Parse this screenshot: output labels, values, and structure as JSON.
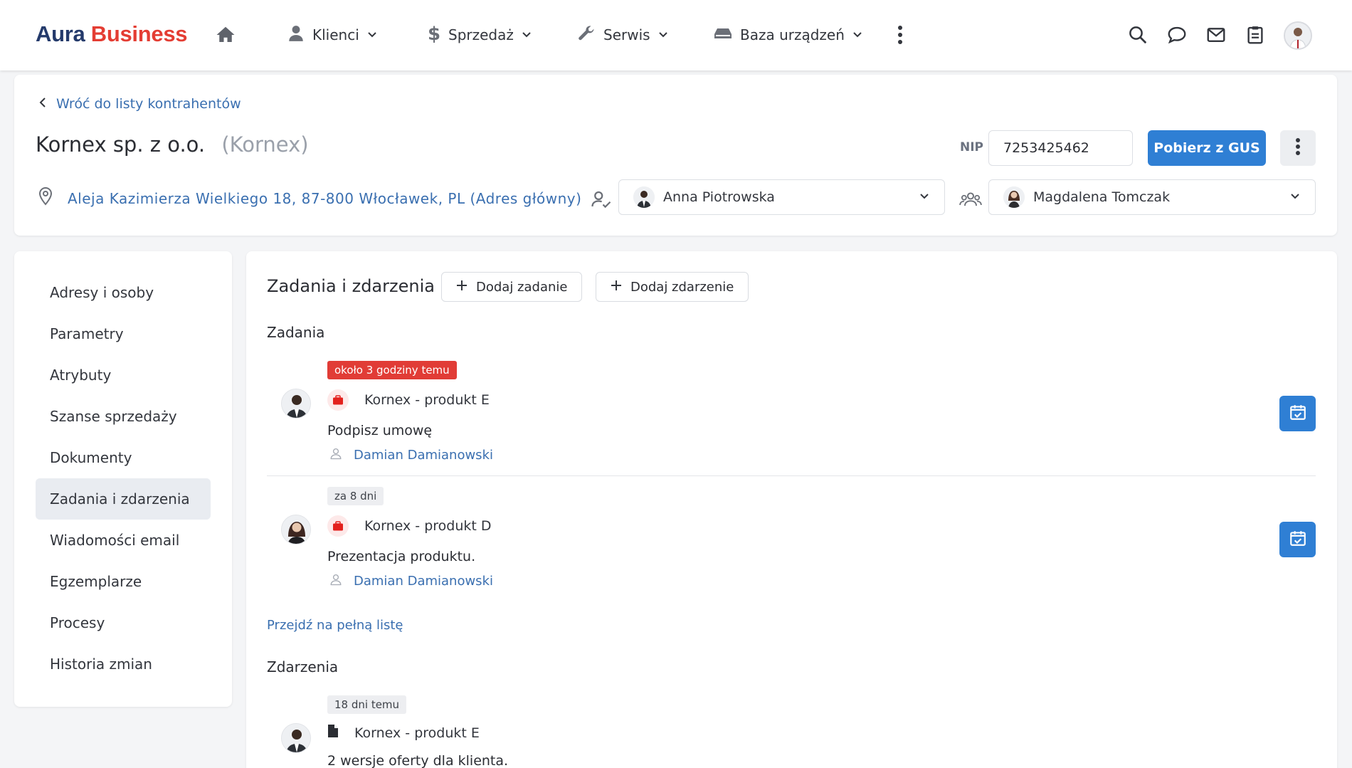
{
  "brand": {
    "part1": "Aura",
    "part2": "Business"
  },
  "nav": {
    "items": [
      {
        "label": "Klienci",
        "icon": "person-icon"
      },
      {
        "label": "Sprzedaż",
        "icon": "dollar-icon"
      },
      {
        "label": "Serwis",
        "icon": "wrench-icon"
      },
      {
        "label": "Baza urządzeń",
        "icon": "devices-icon"
      }
    ],
    "right_icons": [
      "search-icon",
      "chat-icon",
      "mail-icon",
      "clipboard-icon"
    ]
  },
  "header": {
    "back_label": "Wróć do listy kontrahentów",
    "company_name": "Kornex sp. z o.o.",
    "company_short": "(Kornex)",
    "nip_label": "NIP",
    "nip_value": "7253425462",
    "gus_button": "Pobierz z GUS",
    "address": "Aleja Kazimierza Wielkiego 18, 87-800 Włocławek, PL (Adres główny)",
    "owner": "Anna Piotrowska",
    "team": "Magdalena Tomczak"
  },
  "sidebar": {
    "items": [
      {
        "label": "Adresy i osoby"
      },
      {
        "label": "Parametry"
      },
      {
        "label": "Atrybuty"
      },
      {
        "label": "Szanse sprzedaży"
      },
      {
        "label": "Dokumenty"
      },
      {
        "label": "Zadania i zdarzenia",
        "active": true
      },
      {
        "label": "Wiadomości email"
      },
      {
        "label": "Egzemplarze"
      },
      {
        "label": "Procesy"
      },
      {
        "label": "Historia zmian"
      }
    ]
  },
  "main": {
    "title": "Zadania i zdarzenia",
    "add_task": "Dodaj zadanie",
    "add_event": "Dodaj zdarzenie",
    "tasks_title": "Zadania",
    "tasks": [
      {
        "badge": "około 3 godziny temu",
        "badge_color": "#e13c36",
        "product": "Kornex - produkt E",
        "description": "Podpisz umowę",
        "assignee": "Damian Damianowski"
      },
      {
        "badge": "za 8 dni",
        "badge_color": "#edeef1",
        "product": "Kornex - produkt D",
        "description": "Prezentacja produktu.",
        "assignee": "Damian Damianowski"
      }
    ],
    "full_list_link": "Przejdź na pełną listę",
    "events_title": "Zdarzenia",
    "events": [
      {
        "badge": "18 dni temu",
        "product": "Kornex - produkt E",
        "description": "2 wersje oferty dla klienta."
      }
    ]
  },
  "colors": {
    "brand_dark": "#243a6b",
    "brand_red": "#e43d33",
    "primary": "#2f7fd4",
    "link": "#3a6fb0"
  }
}
